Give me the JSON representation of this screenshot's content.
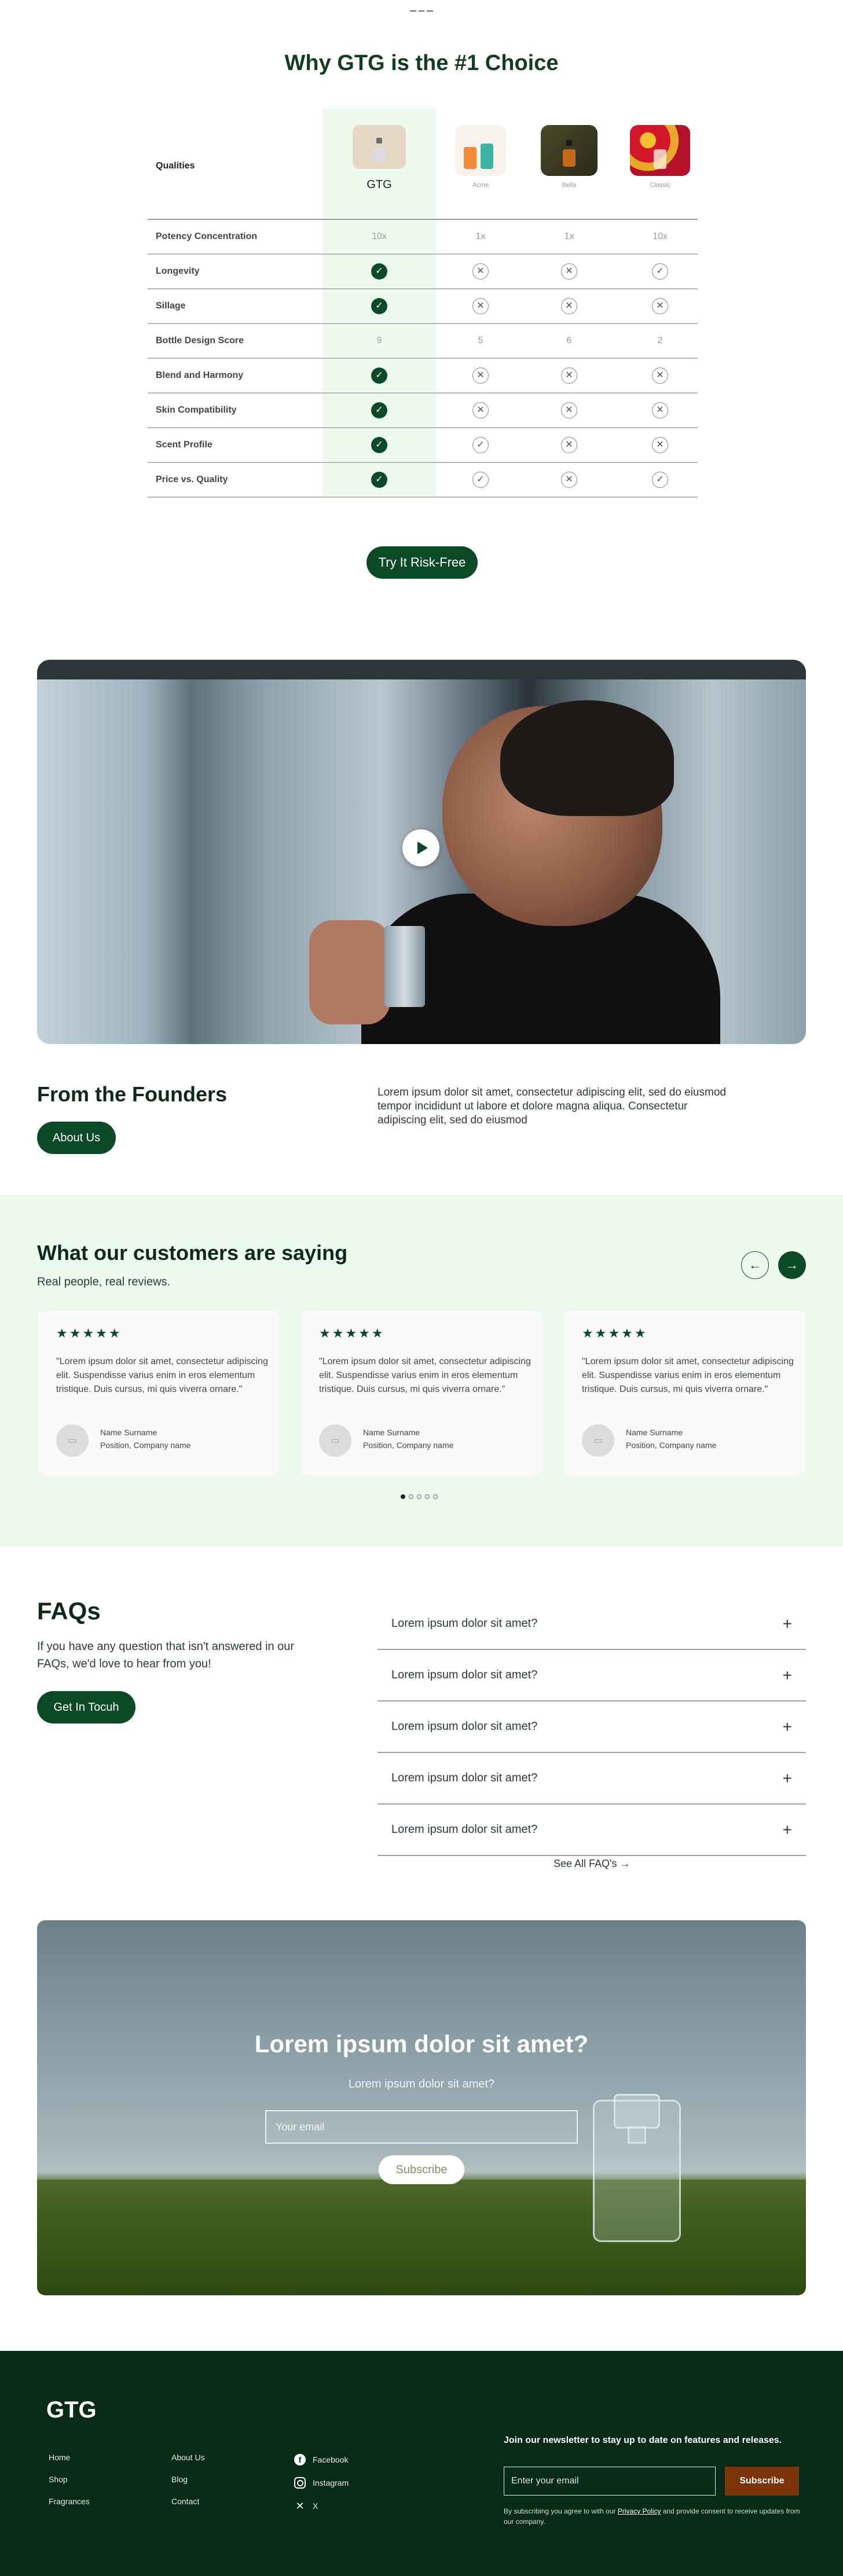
{
  "compare": {
    "title": "Why GTG is the #1 Choice",
    "qualities_label": "Qualities",
    "brands": [
      {
        "name": "GTG",
        "color": "#e6d8c4"
      },
      {
        "name": "Acme",
        "color": "#f5f0ea"
      },
      {
        "name": "Bella",
        "color": "#3d3a20"
      },
      {
        "name": "Classic",
        "color": "#c91a2a"
      }
    ],
    "rows": [
      {
        "label": "Potency Concentration",
        "cells": [
          "10x",
          "1x",
          "1x",
          "10x"
        ]
      },
      {
        "label": "Longevity",
        "cells": [
          "yes",
          "no",
          "no",
          "ok"
        ]
      },
      {
        "label": "Sillage",
        "cells": [
          "yes",
          "no",
          "no",
          "no"
        ]
      },
      {
        "label": "Bottle Design Score",
        "cells": [
          "9",
          "5",
          "6",
          "2"
        ]
      },
      {
        "label": "Blend and Harmony",
        "cells": [
          "yes",
          "no",
          "no",
          "no"
        ]
      },
      {
        "label": "Skin Compatibility",
        "cells": [
          "yes",
          "no",
          "no",
          "no"
        ]
      },
      {
        "label": "Scent Profile",
        "cells": [
          "yes",
          "ok",
          "no",
          "no"
        ]
      },
      {
        "label": "Price vs. Quality",
        "cells": [
          "yes",
          "ok",
          "no",
          "ok"
        ]
      }
    ],
    "cta_label": "Try It Risk-Free"
  },
  "video": {
    "play_icon": "play-icon"
  },
  "founders": {
    "title": "From the Founders",
    "text": "Lorem ipsum dolor sit amet, consectetur adipiscing elit, sed do eiusmod tempor incididunt ut labore et dolore magna aliqua. Consectetur adipiscing elit, sed do eiusmod",
    "button_label": "About Us"
  },
  "testimonials": {
    "title": "What our customers are saying",
    "subtitle": "Real people, real reviews.",
    "prev_icon": "arrow-left-icon",
    "next_icon": "arrow-right-icon",
    "cards": [
      {
        "stars": "★★★★★",
        "quote": "\"Lorem ipsum dolor sit amet, consectetur adipiscing elit. Suspendisse varius enim in eros elementum tristique. Duis cursus, mi quis viverra ornare.\"",
        "name": "Name Surname",
        "position": "Position, Company name"
      },
      {
        "stars": "★★★★★",
        "quote": "\"Lorem ipsum dolor sit amet, consectetur adipiscing elit. Suspendisse varius enim in eros elementum tristique. Duis cursus, mi quis viverra ornare.\"",
        "name": "Name Surname",
        "position": "Position, Company name"
      },
      {
        "stars": "★★★★★",
        "quote": "\"Lorem ipsum dolor sit amet, consectetur adipiscing elit. Suspendisse varius enim in eros elementum tristique. Duis cursus, mi quis viverra ornare.\"",
        "name": "Name Surname",
        "position": "Position, Company name"
      }
    ],
    "dots_total": 5,
    "dots_active": 1
  },
  "faq": {
    "title": "FAQs",
    "description": "If you have any question that isn't answered in our FAQs, we'd love to hear from you!",
    "button_label": "Get In Tocuh",
    "items": [
      "Lorem ipsum dolor sit amet?",
      "Lorem ipsum dolor sit amet?",
      "Lorem ipsum dolor sit amet?",
      "Lorem ipsum dolor sit amet?",
      "Lorem ipsum dolor sit amet?"
    ],
    "see_all_label": "See All FAQ's →"
  },
  "banner": {
    "title": "Lorem ipsum dolor sit amet?",
    "subtitle": "Lorem ipsum dolor sit amet?",
    "email_placeholder": "Your email",
    "button_label": "Subscribe"
  },
  "footer": {
    "logo": "GTG",
    "col1": [
      "Home",
      "Shop",
      "Fragrances"
    ],
    "col2": [
      "About Us",
      "Blog",
      "Contact"
    ],
    "social": [
      {
        "label": "Facebook",
        "icon": "facebook-icon"
      },
      {
        "label": "Instagram",
        "icon": "instagram-icon"
      },
      {
        "label": "X",
        "icon": "x-icon"
      }
    ],
    "newsletter_title": "Join our newsletter to stay up to date on features and releases.",
    "email_placeholder": "Enter your email",
    "subscribe_label": "Subscribe",
    "consent_pre": "By subscribing you agree to with our ",
    "consent_link": "Privacy Policy",
    "consent_post": " and provide consent to receive updates from our company."
  },
  "colors": {
    "brand_green": "#0b4a26",
    "footer_bg": "#072b17",
    "testimonial_bg": "#ecfbee",
    "footer_button": "#7a3408"
  }
}
